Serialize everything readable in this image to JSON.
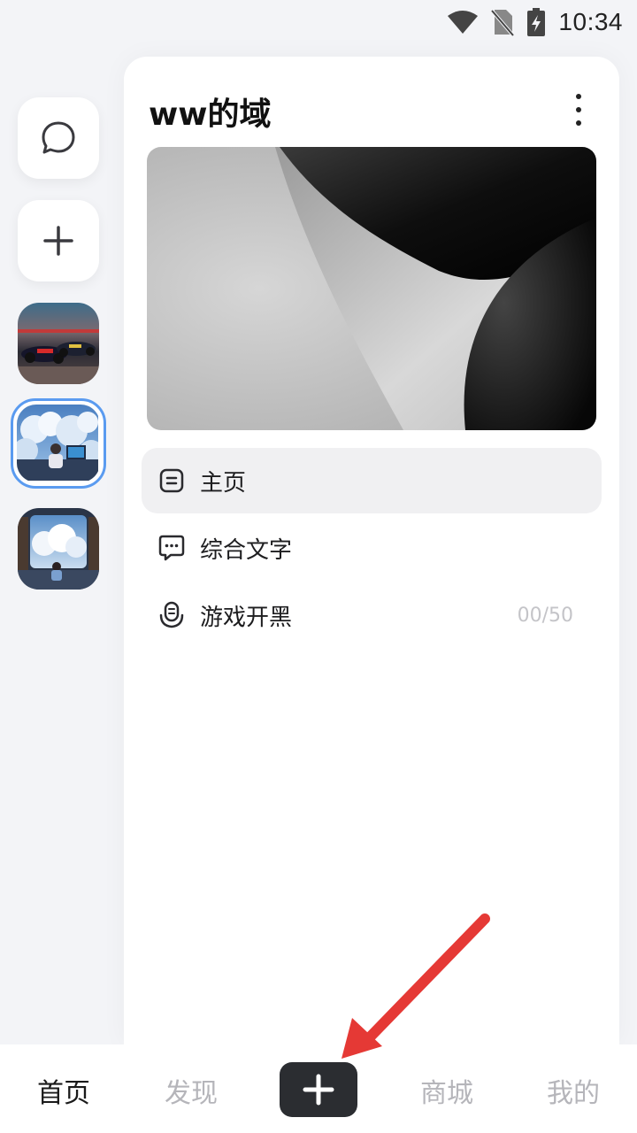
{
  "status_bar": {
    "time": "10:34",
    "icons": [
      "wifi-icon",
      "no-sim-icon",
      "battery-charging-icon"
    ]
  },
  "rail": {
    "chat_button": {
      "icon": "chat-bubble-icon"
    },
    "add_button": {
      "icon": "plus-icon"
    },
    "servers": [
      {
        "name": "f1-cars-avatar",
        "selected": false
      },
      {
        "name": "cloud-desk-avatar",
        "selected": true
      },
      {
        "name": "cloud-library-avatar",
        "selected": false
      }
    ]
  },
  "panel": {
    "title": "ww的域",
    "channels": [
      {
        "label": "主页",
        "icon": "document-lines-icon",
        "active": true,
        "count": ""
      },
      {
        "label": "综合文字",
        "icon": "message-dots-icon",
        "active": false,
        "count": ""
      },
      {
        "label": "游戏开黑",
        "icon": "mic-icon",
        "active": false,
        "count": "00/50"
      }
    ]
  },
  "bottom_nav": {
    "items": [
      "首页",
      "发现",
      "商城",
      "我的"
    ],
    "active": "首页",
    "center_button_icon": "plus-icon"
  },
  "colors": {
    "accent_selected": "#5a9bf0",
    "annotation_arrow": "#e53935",
    "nav_plus_bg": "#2b2d31"
  }
}
